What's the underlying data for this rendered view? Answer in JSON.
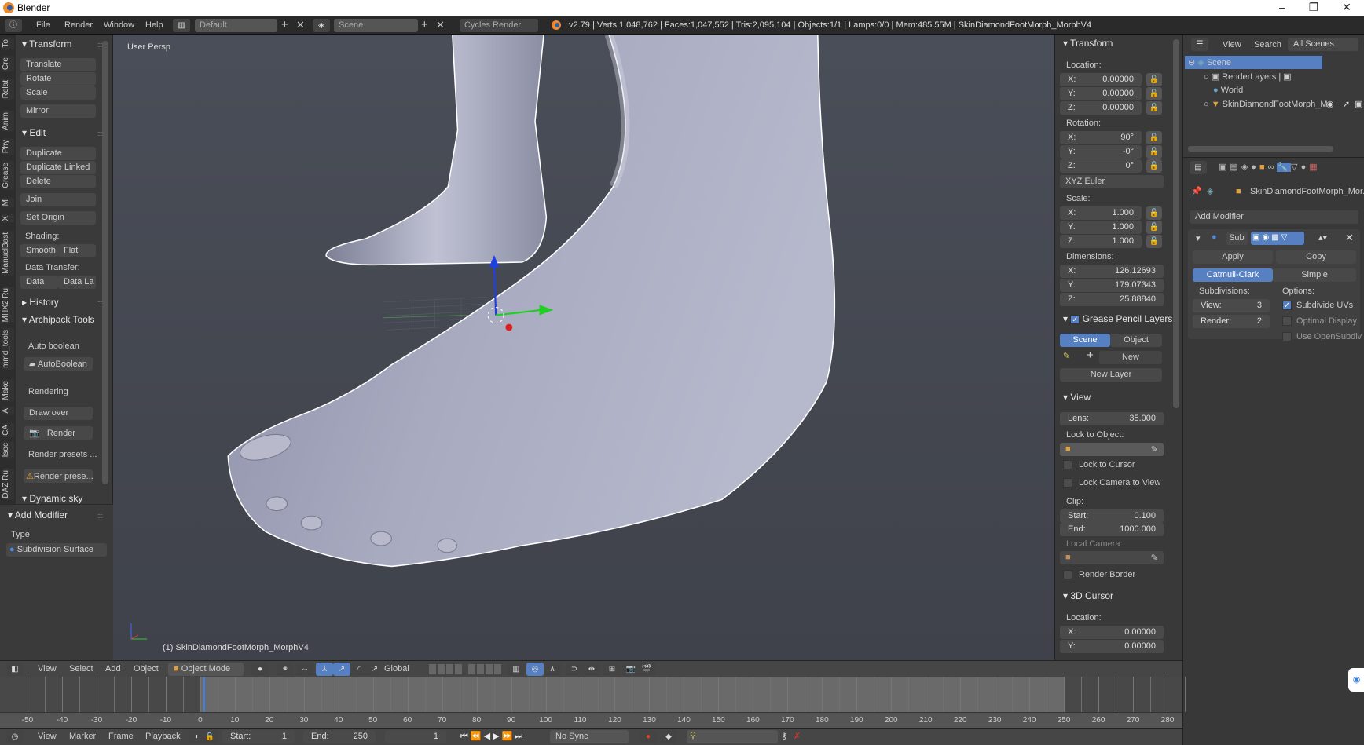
{
  "window": {
    "title": "Blender",
    "minimize": "–",
    "maximize": "❐",
    "close": "✕"
  },
  "topbar": {
    "menus": [
      "File",
      "Render",
      "Window",
      "Help"
    ],
    "layout": "Default",
    "scene": "Scene",
    "engine": "Cycles Render",
    "stats": "v2.79 | Verts:1,048,762 | Faces:1,047,552 | Tris:2,095,104 | Objects:1/1 | Lamps:0/0 | Mem:485.55M | SkinDiamondFootMorph_MorphV4",
    "add": "+",
    "remove": "✕"
  },
  "tabs": [
    "To",
    "Cre",
    "Relat",
    "Anim",
    "Phy",
    "Grease",
    "M",
    "X",
    "ManuelBast",
    "MHX2 Ru",
    "mmd_tools",
    "Make",
    "A",
    "CA",
    "Isoc",
    "DAZ Ru"
  ],
  "toolshelf": {
    "transform": {
      "title": "Transform",
      "items": [
        "Translate",
        "Rotate",
        "Scale",
        "Mirror"
      ]
    },
    "edit": {
      "title": "Edit",
      "items": [
        "Duplicate",
        "Duplicate Linked",
        "Delete",
        "Join",
        "Set Origin"
      ],
      "shading_label": "Shading:",
      "smooth": "Smooth",
      "flat": "Flat",
      "transfer_label": "Data Transfer:",
      "data": "Data",
      "data_la": "Data La"
    },
    "history": {
      "title": "History"
    },
    "archipack": {
      "title": "Archipack Tools",
      "auto_boolean": "Auto boolean",
      "autoboolean_btn": "AutoBoolean",
      "rendering": "Rendering",
      "draw_over": "Draw over",
      "render": "Render",
      "render_presets": "Render presets ...",
      "render_prese": "Render prese..."
    },
    "dynamic_sky": {
      "title": "Dynamic sky"
    },
    "add_modifier": {
      "title": "Add Modifier",
      "type_label": "Type",
      "type_value": "Subdivision Surface"
    }
  },
  "viewport": {
    "view_name": "User Persp",
    "object_label": "(1) SkinDiamondFootMorph_MorphV4"
  },
  "npanel": {
    "transform": {
      "title": "Transform",
      "location": "Location:",
      "loc": [
        [
          "X:",
          "0.00000"
        ],
        [
          "Y:",
          "0.00000"
        ],
        [
          "Z:",
          "0.00000"
        ]
      ],
      "rotation": "Rotation:",
      "rot": [
        [
          "X:",
          "90°"
        ],
        [
          "Y:",
          "-0°"
        ],
        [
          "Z:",
          "0°"
        ]
      ],
      "rot_mode": "XYZ Euler",
      "scale": "Scale:",
      "scl": [
        [
          "X:",
          "1.000"
        ],
        [
          "Y:",
          "1.000"
        ],
        [
          "Z:",
          "1.000"
        ]
      ],
      "dimensions": "Dimensions:",
      "dim": [
        [
          "X:",
          "126.12693"
        ],
        [
          "Y:",
          "179.07343"
        ],
        [
          "Z:",
          "25.88840"
        ]
      ]
    },
    "grease": {
      "title": "Grease Pencil Layers",
      "scene": "Scene",
      "object": "Object",
      "new": "New",
      "new_layer": "New Layer",
      "enabled": true
    },
    "view": {
      "title": "View",
      "lens_k": "Lens:",
      "lens_v": "35.000",
      "lock_obj": "Lock to Object:",
      "lock_cursor": "Lock to Cursor",
      "lock_camera": "Lock Camera to View",
      "clip": "Clip:",
      "start_k": "Start:",
      "start_v": "0.100",
      "end_k": "End:",
      "end_v": "1000.000",
      "local_camera": "Local Camera:",
      "render_border": "Render Border"
    },
    "cursor": {
      "title": "3D Cursor",
      "location": "Location:",
      "loc": [
        [
          "X:",
          "0.00000"
        ],
        [
          "Y:",
          "0.00000"
        ]
      ]
    }
  },
  "outliner": {
    "view": "View",
    "search": "Search",
    "filter": "All Scenes",
    "items": [
      "Scene",
      "RenderLayers",
      "World",
      "SkinDiamondFootMorph_M"
    ]
  },
  "properties": {
    "object_name": "SkinDiamondFootMorph_Mor...",
    "add_modifier": "Add Modifier",
    "mod_name": "Sub",
    "apply": "Apply",
    "copy": "Copy",
    "catmull": "Catmull-Clark",
    "simple": "Simple",
    "subdivisions": "Subdivisions:",
    "options": "Options:",
    "view_k": "View:",
    "view_v": "3",
    "render_k": "Render:",
    "render_v": "2",
    "subdivide_uvs": "Subdivide UVs",
    "optimal_display": "Optimal Display",
    "use_opensubdiv": "Use OpenSubdiv",
    "subdivide_uvs_on": true
  },
  "view3d_header": {
    "menus": [
      "View",
      "Select",
      "Add",
      "Object"
    ],
    "mode": "Object Mode",
    "orientation": "Global"
  },
  "timeline": {
    "ticks": [
      -50,
      -40,
      -30,
      -20,
      -10,
      0,
      10,
      20,
      30,
      40,
      50,
      60,
      70,
      80,
      90,
      100,
      110,
      120,
      130,
      140,
      150,
      160,
      170,
      180,
      190,
      200,
      210,
      220,
      230,
      240,
      250,
      260,
      270,
      280
    ],
    "current_frame": 1,
    "start": 1,
    "end": 250
  },
  "timeline_header": {
    "menus": [
      "View",
      "Marker",
      "Frame",
      "Playback"
    ],
    "start_k": "Start:",
    "start_v": "1",
    "end_k": "End:",
    "end_v": "250",
    "frame": "1",
    "sync": "No Sync",
    "transport": [
      "⏮",
      "⏪",
      "◀",
      "▶",
      "⏩",
      "⏭"
    ]
  },
  "colors": {
    "accent": "#5680c2",
    "selected_row": "#5680c2"
  }
}
